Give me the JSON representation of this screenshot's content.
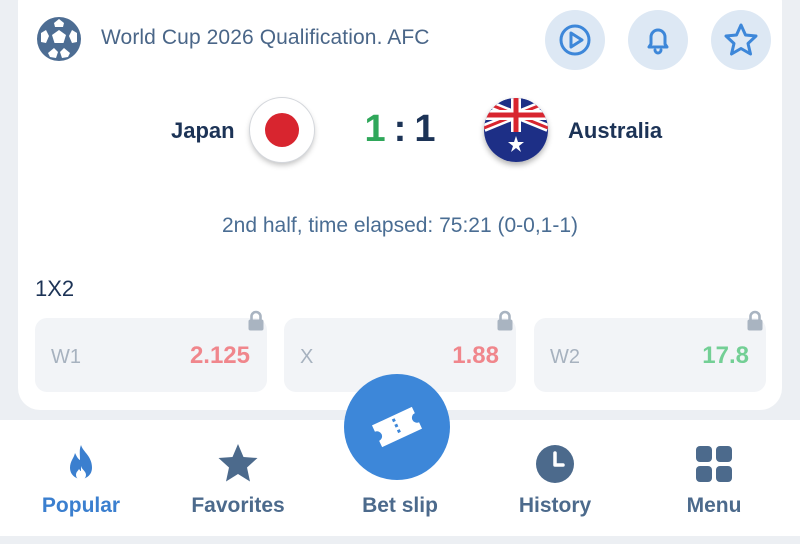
{
  "match": {
    "league": "World Cup 2026 Qualification. AFC",
    "home_team": "Japan",
    "away_team": "Australia",
    "home_score": "1",
    "separator": ":",
    "away_score": "1",
    "status": "2nd half, time elapsed: 75:21 (0-0,1-1)"
  },
  "header_buttons": {
    "play": "play-icon",
    "bell": "bell-icon",
    "favorite": "star-icon"
  },
  "market": {
    "title": "1X2",
    "odds": [
      {
        "label": "W1",
        "value": "2.125",
        "color": "#f0868c",
        "locked": true
      },
      {
        "label": "X",
        "value": "1.88",
        "color": "#f0868c",
        "locked": true
      },
      {
        "label": "W2",
        "value": "17.8",
        "color": "#73cf95",
        "locked": true
      }
    ]
  },
  "nav": {
    "items": [
      {
        "label": "Popular",
        "icon": "flame-icon",
        "active": true
      },
      {
        "label": "Favorites",
        "icon": "star-icon",
        "active": false
      },
      {
        "label": "Bet slip",
        "icon": "ticket-icon",
        "active": false
      },
      {
        "label": "History",
        "icon": "clock-icon",
        "active": false
      },
      {
        "label": "Menu",
        "icon": "grid-icon",
        "active": false
      }
    ]
  },
  "colors": {
    "accent": "#3d87d9",
    "text_dark": "#1c3356",
    "score_home": "#2fa75a",
    "odd_down": "#f0868c",
    "odd_up": "#73cf95"
  }
}
